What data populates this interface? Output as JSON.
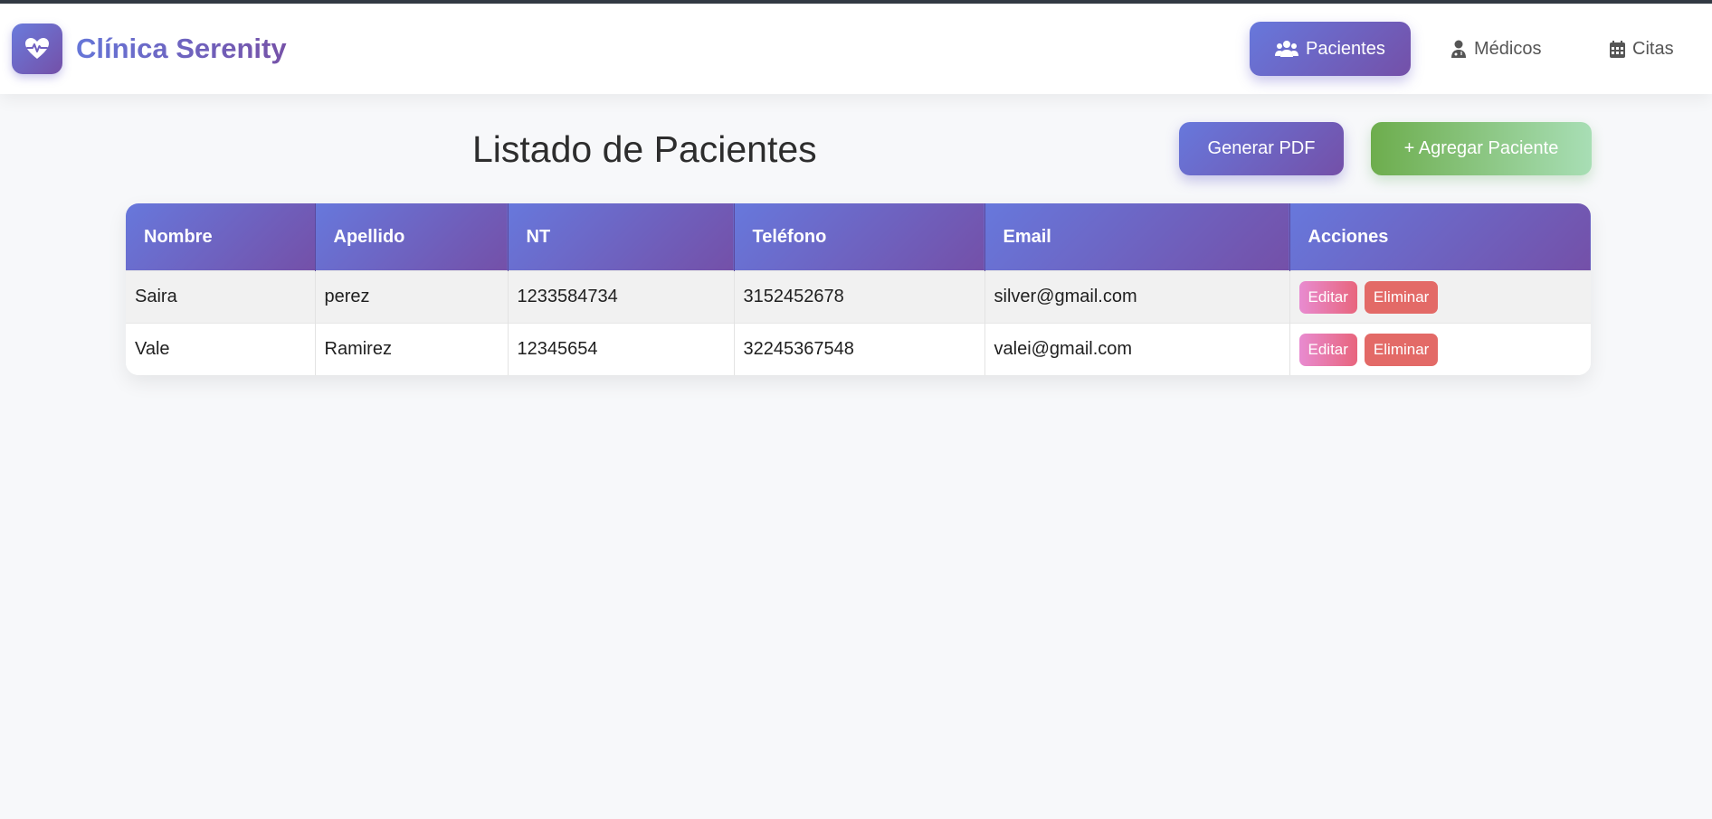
{
  "brand": {
    "name": "Clínica Serenity",
    "icon": "heartbeat-icon"
  },
  "nav": {
    "items": [
      {
        "label": "Pacientes",
        "icon": "users-icon",
        "active": true
      },
      {
        "label": "Médicos",
        "icon": "doctor-icon",
        "active": false
      },
      {
        "label": "Citas",
        "icon": "calendar-icon",
        "active": false
      }
    ]
  },
  "page": {
    "title": "Listado de Pacientes",
    "pdf_button": "Generar PDF",
    "add_button": "+ Agregar Paciente"
  },
  "table": {
    "columns": [
      "Nombre",
      "Apellido",
      "NT",
      "Teléfono",
      "Email",
      "Acciones"
    ],
    "rows": [
      {
        "nombre": "Saira",
        "apellido": "perez",
        "nt": "1233584734",
        "telefono": "3152452678",
        "email": "silver@gmail.com"
      },
      {
        "nombre": "Vale",
        "apellido": "Ramirez",
        "nt": "12345654",
        "telefono": "32245367548",
        "email": "valei@gmail.com"
      }
    ],
    "actions": {
      "edit": "Editar",
      "delete": "Eliminar"
    }
  },
  "colors": {
    "primary_gradient_start": "#6778dc",
    "primary_gradient_end": "#7450a8",
    "add_gradient_start": "#6dad4d",
    "add_gradient_end": "#a8deb5",
    "edit_gradient_start": "#e88bd0",
    "edit_gradient_end": "#e8657d",
    "delete": "#e36a67"
  }
}
